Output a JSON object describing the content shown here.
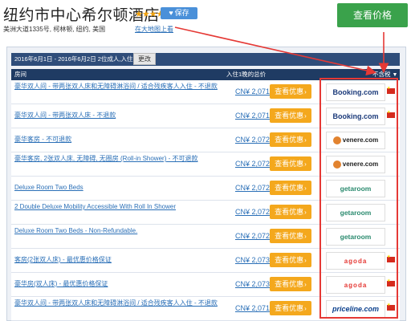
{
  "header": {
    "hotel_name": "纽约市中心希尔顿酒店",
    "stars": "★★★★",
    "save_label": "保存",
    "address": "美洲大道1335号, 柯林顿, 纽约, 美国",
    "map_link": "在大地图上看",
    "view_price_label": "查看价格"
  },
  "search": {
    "date_summary": "2016年6月1日 - 2016年6月2日 2位成人,入住1间",
    "change_label": "更改"
  },
  "table": {
    "col_room": "房间",
    "col_price": "入住1晚的总价",
    "col_tax": "不含税"
  },
  "rows": [
    {
      "room": "豪华双人间 - 带两张双人床和无障碍淋浴间 / 适合残疾客人入住 - 不退款",
      "price": "CN¥ 2,071",
      "deal": "查看优惠",
      "provider": "Booking.com",
      "logo": "booking",
      "flag": true
    },
    {
      "room": "豪华双人间 - 带两张双人床 - 不退款",
      "price": "CN¥ 2,071",
      "deal": "查看优惠",
      "provider": "Booking.com",
      "logo": "booking",
      "flag": true
    },
    {
      "room": "豪华客房 - 不可退款",
      "price": "CN¥ 2,072",
      "deal": "查看优惠",
      "provider": "venere.com",
      "logo": "venere",
      "flag": false
    },
    {
      "room": "豪华客房, 2张双人床, 无障碍, 无圈房 (Roll-in Shower) - 不可退款",
      "price": "CN¥ 2,072",
      "deal": "查看优惠",
      "provider": "venere.com",
      "logo": "venere",
      "flag": false
    },
    {
      "room": "Deluxe Room Two Beds",
      "price": "CN¥ 2,072",
      "deal": "查看优惠",
      "provider": "getaroom",
      "logo": "getaroom",
      "flag": false
    },
    {
      "room": "2 Double Deluxe Mobility Accessible With Roll In Shower",
      "price": "CN¥ 2,072",
      "deal": "查看优惠",
      "provider": "getaroom",
      "logo": "getaroom",
      "flag": false
    },
    {
      "room": "Deluxe Room Two Beds - Non-Refundable.",
      "price": "CN¥ 2,072",
      "deal": "查看优惠",
      "provider": "getaroom",
      "logo": "getaroom",
      "flag": false
    },
    {
      "room": "客房(2张双人床) - 最优惠价格保证",
      "price": "CN¥ 2,073",
      "deal": "查看优惠",
      "provider": "agoda",
      "logo": "agoda",
      "flag": true
    },
    {
      "room": "豪华房(双人床) - 最优惠价格保证",
      "price": "CN¥ 2,073",
      "deal": "查看优惠",
      "provider": "agoda",
      "logo": "agoda",
      "flag": true
    },
    {
      "room": "豪华双人间 - 带两张双人床和无障碍淋浴间 / 适合残疾客人入住 - 不退款",
      "price": "CN¥ 2,071",
      "deal": "查看优惠",
      "provider": "priceline.com",
      "logo": "priceline",
      "flag": true
    }
  ],
  "colors": {
    "accent_green": "#3aa24b",
    "deal_orange": "#f4a81d",
    "header_navy": "#1f3b63",
    "highlight_red": "#e53935"
  }
}
